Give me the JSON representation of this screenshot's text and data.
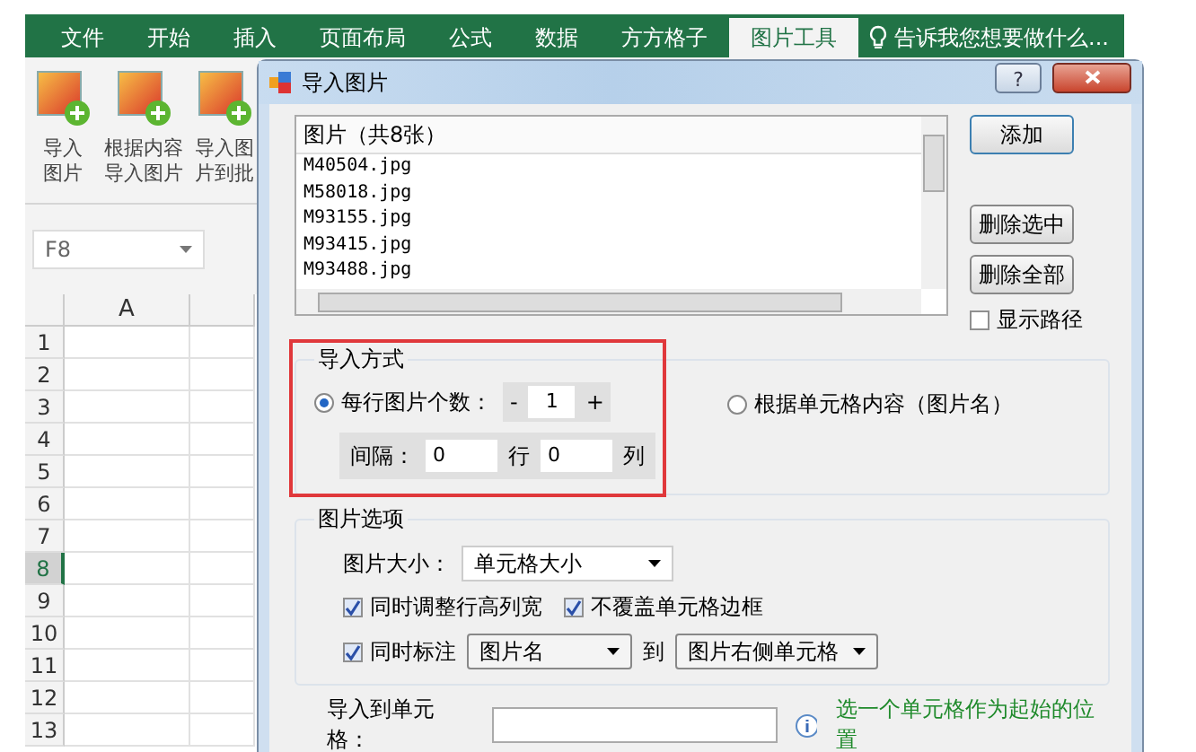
{
  "ribbon_tabs": [
    {
      "label": "文件",
      "selected": false
    },
    {
      "label": "开始",
      "selected": false
    },
    {
      "label": "插入",
      "selected": false
    },
    {
      "label": "页面布局",
      "selected": false
    },
    {
      "label": "公式",
      "selected": false
    },
    {
      "label": "数据",
      "selected": false
    },
    {
      "label": "方方格子",
      "selected": false
    },
    {
      "label": "图片工具",
      "selected": true
    }
  ],
  "tell_me": {
    "placeholder": "告诉我您想要做什么..."
  },
  "ribbon_buttons": [
    {
      "lines": [
        "导入",
        "图片"
      ]
    },
    {
      "lines": [
        "根据内容",
        "导入图片"
      ]
    },
    {
      "lines": [
        "导入图",
        "片到批"
      ]
    }
  ],
  "name_box": {
    "value": "F8"
  },
  "sheet": {
    "columns": [
      "A"
    ],
    "rows": [
      {
        "label": "1",
        "selected": false
      },
      {
        "label": "2",
        "selected": false
      },
      {
        "label": "3",
        "selected": false
      },
      {
        "label": "4",
        "selected": false
      },
      {
        "label": "5",
        "selected": false
      },
      {
        "label": "6",
        "selected": false
      },
      {
        "label": "7",
        "selected": false
      },
      {
        "label": "8",
        "selected": true
      },
      {
        "label": "9",
        "selected": false
      },
      {
        "label": "10",
        "selected": false
      },
      {
        "label": "11",
        "selected": false
      },
      {
        "label": "12",
        "selected": false
      },
      {
        "label": "13",
        "selected": false
      }
    ]
  },
  "dialog": {
    "title": "导入图片",
    "help_button": "?",
    "file_list": {
      "header": "图片（共8张）",
      "items": [
        "M40504.jpg",
        "M58018.jpg",
        "M93155.jpg",
        "M93415.jpg",
        "M93488.jpg"
      ]
    },
    "buttons": [
      {
        "label": "添加"
      },
      {
        "label": "删除选中"
      },
      {
        "label": "删除全部"
      }
    ],
    "show_path": {
      "label": "显示路径",
      "checked": false
    },
    "import_mode": {
      "title": "导入方式",
      "highlighted": true,
      "options": [
        {
          "label": "每行图片个数：",
          "selected": true
        },
        {
          "label": "根据单元格内容（图片名）",
          "selected": false
        }
      ],
      "per_row": {
        "minus": "-",
        "value": "1",
        "plus": "+"
      },
      "spacing": {
        "label": "间隔：",
        "rows_value": "0",
        "rows_unit": "行",
        "cols_value": "0",
        "cols_unit": "列"
      }
    },
    "image_options": {
      "title": "图片选项",
      "size_label": "图片大小：",
      "size_value": "单元格大小",
      "checkboxes": [
        {
          "label": "同时调整行高列宽",
          "checked": true
        },
        {
          "label": "不覆盖单元格边框",
          "checked": true
        }
      ],
      "annotate": {
        "label": "同时标注",
        "checked": true,
        "field_value": "图片名",
        "to": "到",
        "position_value": "图片右侧单元格"
      }
    },
    "target": {
      "label": "导入到单元格：",
      "hint": "选一个单元格作为起始的位置"
    }
  }
}
